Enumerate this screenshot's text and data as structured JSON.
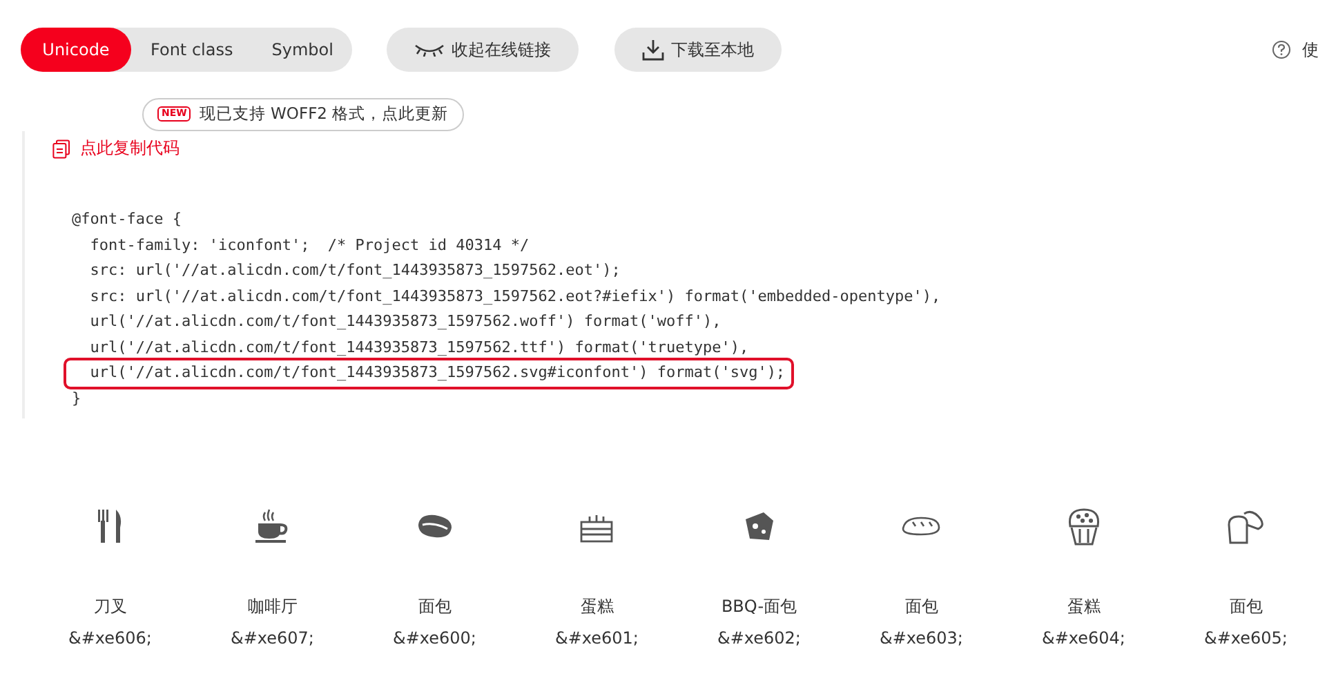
{
  "tabs": [
    {
      "label": "Unicode",
      "selected": true
    },
    {
      "label": "Font class",
      "selected": false
    },
    {
      "label": "Symbol",
      "selected": false
    }
  ],
  "actions": [
    {
      "label": "收起在线链接",
      "kind": "collapse"
    },
    {
      "label": "下载至本地",
      "kind": "download"
    }
  ],
  "help": {
    "label": "使"
  },
  "notice": {
    "badge": "NEW",
    "text": "现已支持 WOFF2 格式，点此更新"
  },
  "copy_link": "点此复制代码",
  "code_lines": [
    {
      "text": "@font-face {",
      "highlighted": false
    },
    {
      "text": "  font-family: 'iconfont';  /* Project id 40314 */",
      "highlighted": false
    },
    {
      "text": "  src: url('//at.alicdn.com/t/font_1443935873_1597562.eot');",
      "highlighted": false
    },
    {
      "text": "  src: url('//at.alicdn.com/t/font_1443935873_1597562.eot?#iefix') format('embedded-opentype'),",
      "highlighted": false
    },
    {
      "text": "  url('//at.alicdn.com/t/font_1443935873_1597562.woff') format('woff'),",
      "highlighted": false
    },
    {
      "text": "  url('//at.alicdn.com/t/font_1443935873_1597562.ttf') format('truetype'),",
      "highlighted": false
    },
    {
      "text": "  url('//at.alicdn.com/t/font_1443935873_1597562.svg#iconfont') format('svg');",
      "highlighted": true
    },
    {
      "text": "}",
      "highlighted": false
    }
  ],
  "icons": [
    {
      "name": "刀叉",
      "code": "&#xe606;"
    },
    {
      "name": "咖啡厅",
      "code": "&#xe607;"
    },
    {
      "name": "面包",
      "code": "&#xe600;"
    },
    {
      "name": "蛋糕",
      "code": "&#xe601;"
    },
    {
      "name": "BBQ-面包",
      "code": "&#xe602;"
    },
    {
      "name": "面包",
      "code": "&#xe603;"
    },
    {
      "name": "蛋糕",
      "code": "&#xe604;"
    },
    {
      "name": "面包",
      "code": "&#xe605;"
    }
  ]
}
